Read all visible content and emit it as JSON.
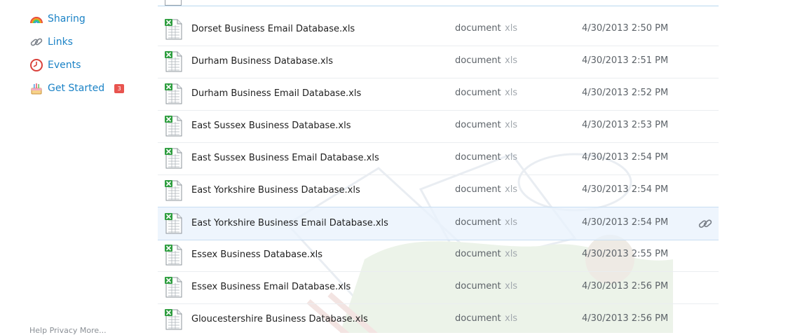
{
  "sidebar": {
    "items": [
      {
        "label": "Sharing",
        "icon": "rainbow-icon"
      },
      {
        "label": "Links",
        "icon": "chain-link-icon"
      },
      {
        "label": "Events",
        "icon": "clock-icon"
      },
      {
        "label": "Get Started",
        "icon": "cake-icon",
        "badge": "3"
      }
    ],
    "footer": "Help  Privacy  More..."
  },
  "files": [
    {
      "name": "Dorset Business Email Database.xls",
      "kind": "document",
      "ext": "xls",
      "modified": "4/30/2013 2:50 PM"
    },
    {
      "name": "Durham Business Database.xls",
      "kind": "document",
      "ext": "xls",
      "modified": "4/30/2013 2:51 PM"
    },
    {
      "name": "Durham Business Email Database.xls",
      "kind": "document",
      "ext": "xls",
      "modified": "4/30/2013 2:52 PM"
    },
    {
      "name": "East Sussex Business Database.xls",
      "kind": "document",
      "ext": "xls",
      "modified": "4/30/2013 2:53 PM"
    },
    {
      "name": "East Sussex Business Email Database.xls",
      "kind": "document",
      "ext": "xls",
      "modified": "4/30/2013 2:54 PM"
    },
    {
      "name": "East Yorkshire Business Database.xls",
      "kind": "document",
      "ext": "xls",
      "modified": "4/30/2013 2:54 PM"
    },
    {
      "name": "East Yorkshire Business Email Database.xls",
      "kind": "document",
      "ext": "xls",
      "modified": "4/30/2013 2:54 PM"
    },
    {
      "name": "Essex Business Database.xls",
      "kind": "document",
      "ext": "xls",
      "modified": "4/30/2013 2:55 PM"
    },
    {
      "name": "Essex Business Email Database.xls",
      "kind": "document",
      "ext": "xls",
      "modified": "4/30/2013 2:56 PM"
    },
    {
      "name": "Gloucestershire Business Database.xls",
      "kind": "document",
      "ext": "xls",
      "modified": "4/30/2013 2:56 PM"
    }
  ],
  "selected_row": 6,
  "colors": {
    "link": "#1a82c6",
    "badge": "#e8544f",
    "excel_green": "#2e9e3f",
    "selection": "#e8f2fc"
  }
}
